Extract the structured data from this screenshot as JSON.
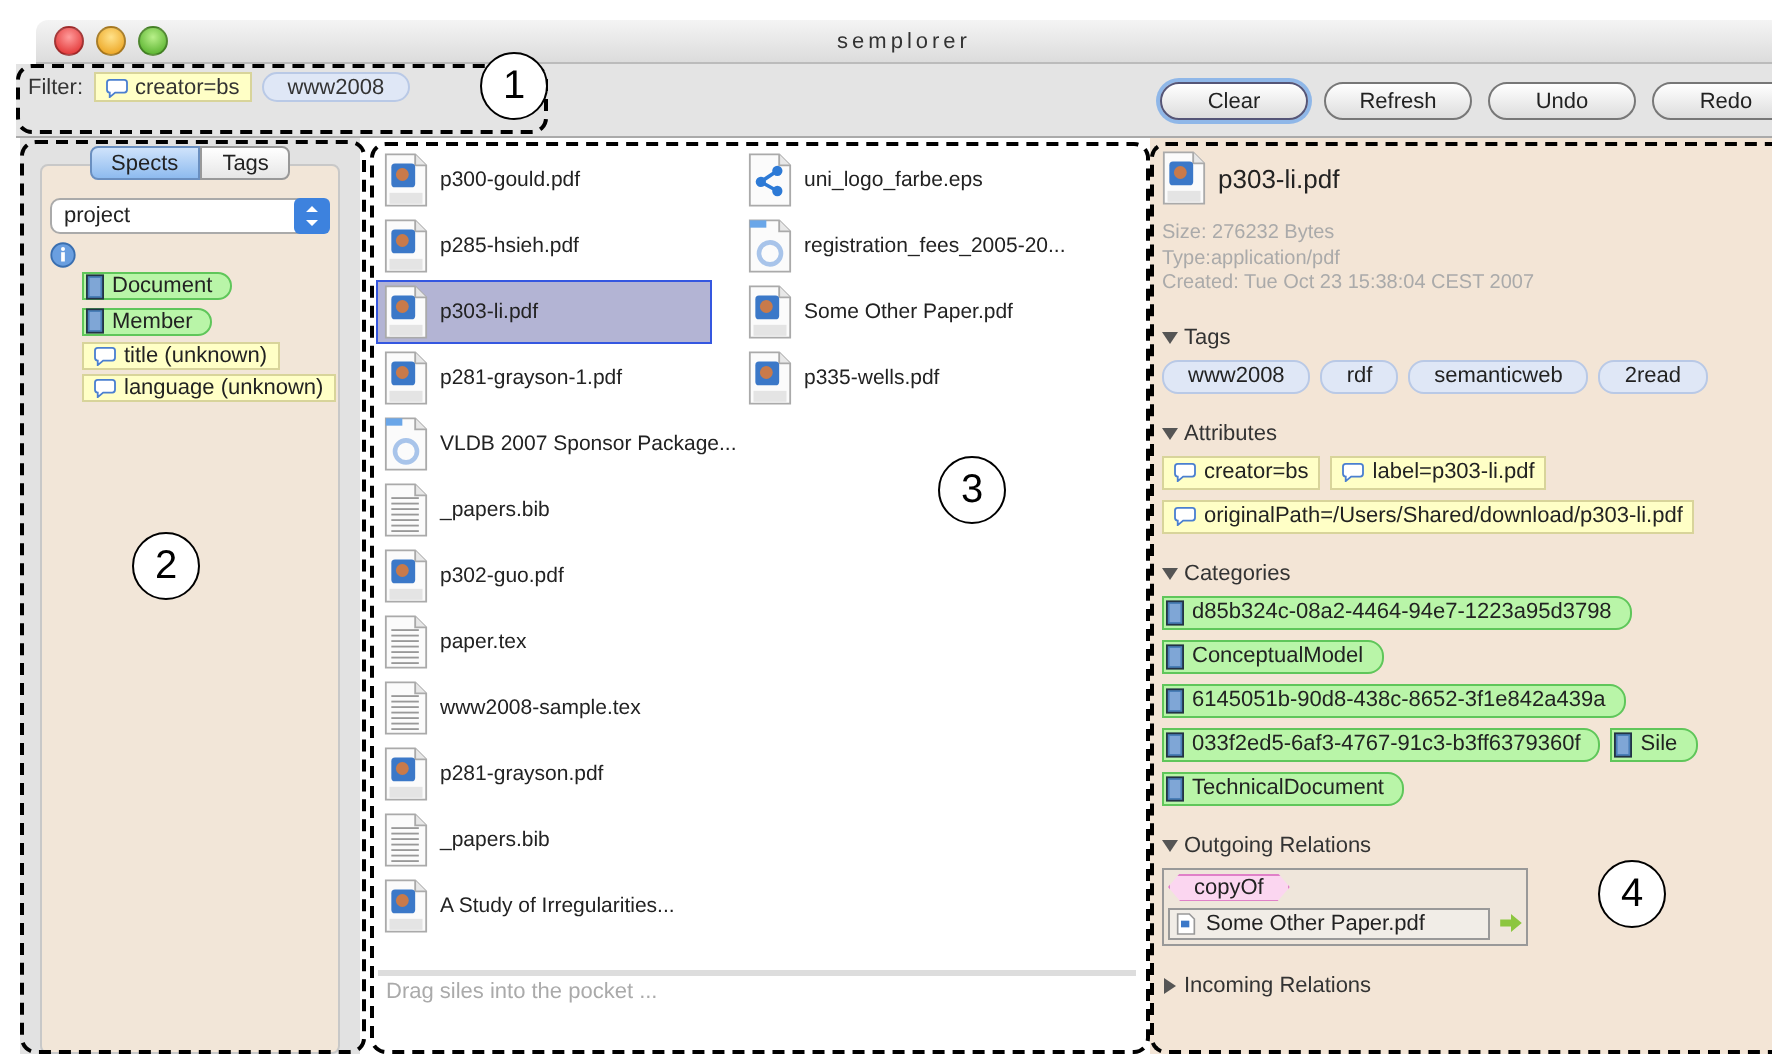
{
  "window": {
    "title": "semplorer"
  },
  "filter": {
    "label": "Filter:",
    "chips": [
      {
        "kind": "attribute",
        "text": "creator=bs"
      },
      {
        "kind": "tag",
        "text": "www2008"
      }
    ]
  },
  "buttons": [
    {
      "label": "Clear",
      "focused": true
    },
    {
      "label": "Refresh",
      "focused": false
    },
    {
      "label": "Undo",
      "focused": false
    },
    {
      "label": "Redo",
      "focused": false
    }
  ],
  "sidebar": {
    "tabs": [
      {
        "label": "Spects",
        "selected": true
      },
      {
        "label": "Tags",
        "selected": false
      }
    ],
    "dropdown": {
      "value": "project"
    },
    "items": [
      {
        "kind": "category",
        "text": "Document"
      },
      {
        "kind": "category",
        "text": "Member"
      },
      {
        "kind": "attribute",
        "text": "title (unknown)"
      },
      {
        "kind": "attribute",
        "text": "language (unknown)"
      }
    ]
  },
  "files": {
    "columns": [
      [
        {
          "name": "p300-gould.pdf",
          "kind": "pdf",
          "selected": false
        },
        {
          "name": "p285-hsieh.pdf",
          "kind": "pdf",
          "selected": false
        },
        {
          "name": "p303-li.pdf",
          "kind": "pdf",
          "selected": true
        },
        {
          "name": "p281-grayson-1.pdf",
          "kind": "pdf",
          "selected": false
        },
        {
          "name": "VLDB 2007 Sponsor Package...",
          "kind": "clipping",
          "selected": false
        },
        {
          "name": "_papers.bib",
          "kind": "text",
          "selected": false
        },
        {
          "name": "p302-guo.pdf",
          "kind": "pdf",
          "selected": false
        },
        {
          "name": "paper.tex",
          "kind": "text",
          "selected": false
        },
        {
          "name": "www2008-sample.tex",
          "kind": "text",
          "selected": false
        },
        {
          "name": "p281-grayson.pdf",
          "kind": "pdf",
          "selected": false
        },
        {
          "name": "_papers.bib",
          "kind": "text",
          "selected": false
        },
        {
          "name": "A Study of Irregularities...",
          "kind": "pdf",
          "selected": false
        }
      ],
      [
        {
          "name": "uni_logo_farbe.eps",
          "kind": "graphic",
          "selected": false
        },
        {
          "name": "registration_fees_2005-20...",
          "kind": "clipping",
          "selected": false
        },
        {
          "name": "Some Other Paper.pdf",
          "kind": "pdf",
          "selected": false
        },
        {
          "name": "p335-wells.pdf",
          "kind": "pdf",
          "selected": false
        }
      ]
    ],
    "pocket": {
      "placeholder": "Drag siles into the pocket ..."
    }
  },
  "details": {
    "title": "p303-li.pdf",
    "kind": "pdf",
    "meta": [
      "Size: 276232 Bytes",
      "Type:application/pdf",
      "Created: Tue Oct 23 15:38:04 CEST 2007"
    ],
    "sections": [
      {
        "kind": "chips",
        "title": "Tags",
        "expanded": true,
        "rows": [
          [
            {
              "kind": "tag",
              "text": "www2008"
            },
            {
              "kind": "tag",
              "text": "rdf"
            },
            {
              "kind": "tag",
              "text": "semanticweb"
            },
            {
              "kind": "tag",
              "text": "2read"
            }
          ]
        ]
      },
      {
        "kind": "chips",
        "title": "Attributes",
        "expanded": true,
        "rows": [
          [
            {
              "kind": "attribute",
              "text": "creator=bs"
            },
            {
              "kind": "attribute",
              "text": "label=p303-li.pdf"
            }
          ],
          [
            {
              "kind": "attribute",
              "text": "originalPath=/Users/Shared/download/p303-li.pdf"
            }
          ]
        ]
      },
      {
        "kind": "chips",
        "title": "Categories",
        "expanded": true,
        "rows": [
          [
            {
              "kind": "category",
              "text": "d85b324c-08a2-4464-94e7-1223a95d3798"
            }
          ],
          [
            {
              "kind": "category",
              "text": "ConceptualModel"
            }
          ],
          [
            {
              "kind": "category",
              "text": "6145051b-90d8-438c-8652-3f1e842a439a"
            }
          ],
          [
            {
              "kind": "category",
              "text": "033f2ed5-6af3-4767-91c3-b3ff6379360f"
            },
            {
              "kind": "category",
              "text": "Sile"
            }
          ],
          [
            {
              "kind": "category",
              "text": "TechnicalDocument"
            }
          ]
        ]
      },
      {
        "kind": "relations",
        "title": "Outgoing Relations",
        "expanded": true,
        "relations": [
          {
            "relation": "copyOf",
            "target": "Some Other Paper.pdf"
          }
        ]
      },
      {
        "kind": "relations",
        "title": "Incoming Relations",
        "expanded": false
      }
    ]
  },
  "annotations": [
    {
      "label": "1"
    },
    {
      "label": "2"
    },
    {
      "label": "3"
    },
    {
      "label": "4"
    }
  ]
}
